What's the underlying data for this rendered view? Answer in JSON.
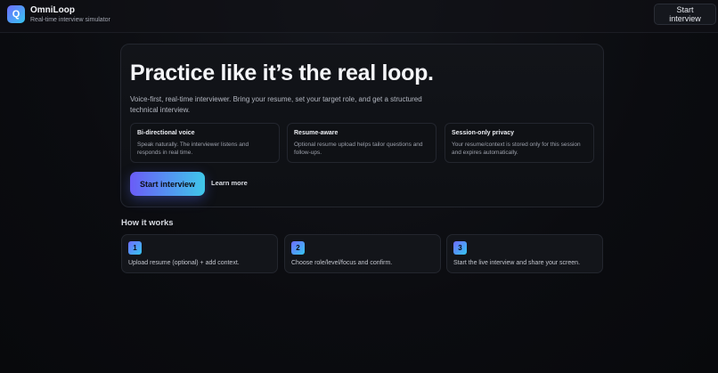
{
  "header": {
    "logo_letter": "Q",
    "brand_name": "OmniLoop",
    "brand_subtitle": "Real-time interview simulator",
    "start_button": "Start interview"
  },
  "hero": {
    "title": "Practice like it’s the real loop.",
    "description": "Voice-first, real-time interviewer. Bring your resume, set your target role, and get a structured technical interview.",
    "features": [
      {
        "title": "Bi-directional voice",
        "text": "Speak naturally. The interviewer listens and responds in real time."
      },
      {
        "title": "Resume-aware",
        "text": "Optional resume upload helps tailor questions and follow-ups."
      },
      {
        "title": "Session-only privacy",
        "text": "Your resume/context is stored only for this session and expires automatically."
      }
    ],
    "cta_label": "Start interview",
    "learn_more": "Learn more"
  },
  "how_it_works": {
    "title": "How it works",
    "steps": [
      {
        "number": "1",
        "text": "Upload resume (optional) + add context."
      },
      {
        "number": "2",
        "text": "Choose role/level/focus and confirm."
      },
      {
        "number": "3",
        "text": "Start the live interview and share your screen."
      }
    ]
  },
  "colors": {
    "accent_start": "#6f6cff",
    "accent_end": "#35c6f0",
    "background": "#0b0c10"
  }
}
